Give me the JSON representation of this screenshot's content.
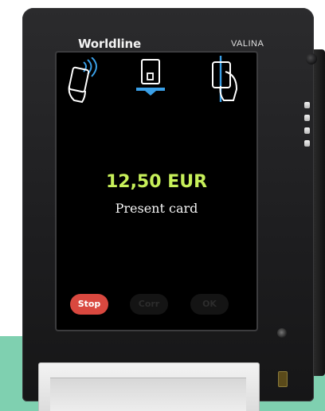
{
  "device": {
    "brand": "Worldline",
    "model": "VALINA"
  },
  "screen": {
    "payment_icons": [
      "contactless-card-icon",
      "insert-card-chip-icon",
      "swipe-card-icon"
    ],
    "amount": "12,50 EUR",
    "prompt": "Present card",
    "buttons": {
      "stop": "Stop",
      "corr": "Corr",
      "ok": "OK"
    }
  },
  "colors": {
    "amount": "#c7f05a",
    "stop_button": "#d9483f",
    "icon_blue": "#3aa0e8",
    "backdrop": "#7fd0b0"
  }
}
